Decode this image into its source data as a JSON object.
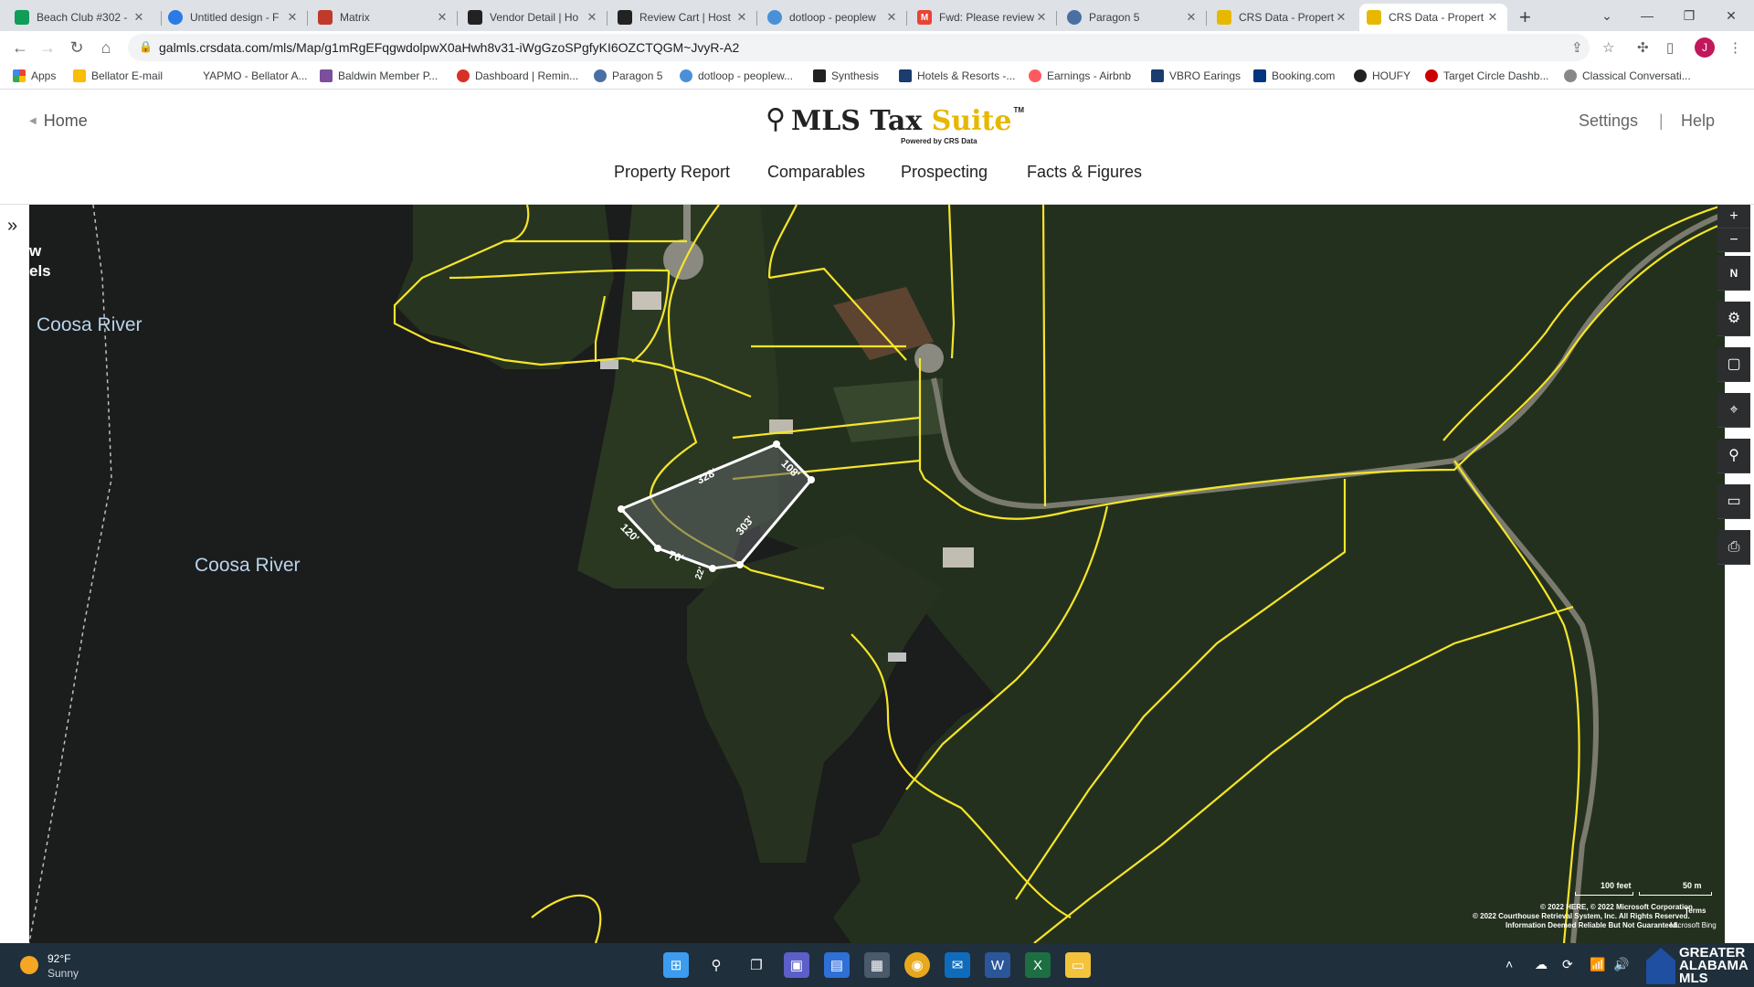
{
  "tabs": [
    {
      "title": "Beach Club #302 -",
      "fav_color": "#0f9d58"
    },
    {
      "title": "Untitled design - F",
      "fav_color": "#2a7be4"
    },
    {
      "title": "Matrix",
      "fav_color": "#c0392b"
    },
    {
      "title": "Vendor Detail | Ho",
      "fav_color": "#222222"
    },
    {
      "title": "Review Cart | Host",
      "fav_color": "#222222"
    },
    {
      "title": "dotloop - peoplew",
      "fav_color": "#4a90d9"
    },
    {
      "title": "Fwd: Please review",
      "fav_color": "#ea4335"
    },
    {
      "title": "Paragon 5",
      "fav_color": "#4a6fa5"
    },
    {
      "title": "CRS Data - Propert",
      "fav_color": "#e6b800"
    },
    {
      "title": "CRS Data - Propert",
      "fav_color": "#e6b800"
    }
  ],
  "address": {
    "url": "galmls.crsdata.com/mls/Map/g1mRgEFqgwdolpwX0aHwh8v31-iWgGzoSPgfyKI6OZCTQGM~JvyR-A2"
  },
  "bookmarks": [
    {
      "label": "Apps",
      "color": "#4285f4"
    },
    {
      "label": "Bellator E-mail",
      "color": "#fbbc04"
    },
    {
      "label": "YAPMO - Bellator A...",
      "color": "#ffffff"
    },
    {
      "label": "Baldwin Member P...",
      "color": "#7b4f9d"
    },
    {
      "label": "Dashboard | Remin...",
      "color": "#d93025"
    },
    {
      "label": "Paragon 5",
      "color": "#4a6fa5"
    },
    {
      "label": "dotloop - peoplew...",
      "color": "#4a90d9"
    },
    {
      "label": "Synthesis",
      "color": "#222222"
    },
    {
      "label": "Hotels & Resorts -...",
      "color": "#1a3c6e"
    },
    {
      "label": "Earnings - Airbnb",
      "color": "#ff5a5f"
    },
    {
      "label": "VBRO Earings",
      "color": "#1a3c6e"
    },
    {
      "label": "Booking.com",
      "color": "#003580"
    },
    {
      "label": "HOUFY",
      "color": "#222222"
    },
    {
      "label": "Target Circle Dashb...",
      "color": "#cc0000"
    },
    {
      "label": "Classical Conversati...",
      "color": "#888888"
    }
  ],
  "header": {
    "home": "Home",
    "logo_main": "MLS Tax ",
    "logo_accent": "Suite",
    "logo_tm": "TM",
    "logo_sub": "Powered by CRS Data",
    "settings": "Settings",
    "divider": "|",
    "help": "Help"
  },
  "nav": [
    "Property Report",
    "Comparables",
    "Prospecting",
    "Facts & Figures"
  ],
  "map": {
    "labels": [
      "Coosa River",
      "Coosa River"
    ],
    "corner_lines": [
      "w",
      "els"
    ],
    "dimensions": [
      "328'",
      "108'",
      "303'",
      "120'",
      "76'",
      "22'"
    ],
    "scale": {
      "feet": "100 feet",
      "meters": "50 m"
    },
    "attribution": [
      "© 2022 HERE, © 2022 Microsoft Corporation",
      "© 2022 Courthouse Retrieval System, Inc. All Rights Reserved.",
      "Information Deemed Reliable But Not Guaranteed.",
      "Terms",
      "Microsoft Bing"
    ]
  },
  "map_tools": [
    "+",
    "−",
    "N",
    "⚙",
    "▢",
    "⌖",
    "⚲",
    "▭",
    "⎙"
  ],
  "taskbar": {
    "temp": "92°F",
    "condition": "Sunny",
    "brand_lines": [
      "GREATER",
      "ALABAMA",
      "MLS"
    ]
  },
  "colors": {
    "parcel_line": "#f5e52a",
    "selected_parcel": "#ffffff",
    "water": "#1b1c1c",
    "forest": "#26331f"
  }
}
